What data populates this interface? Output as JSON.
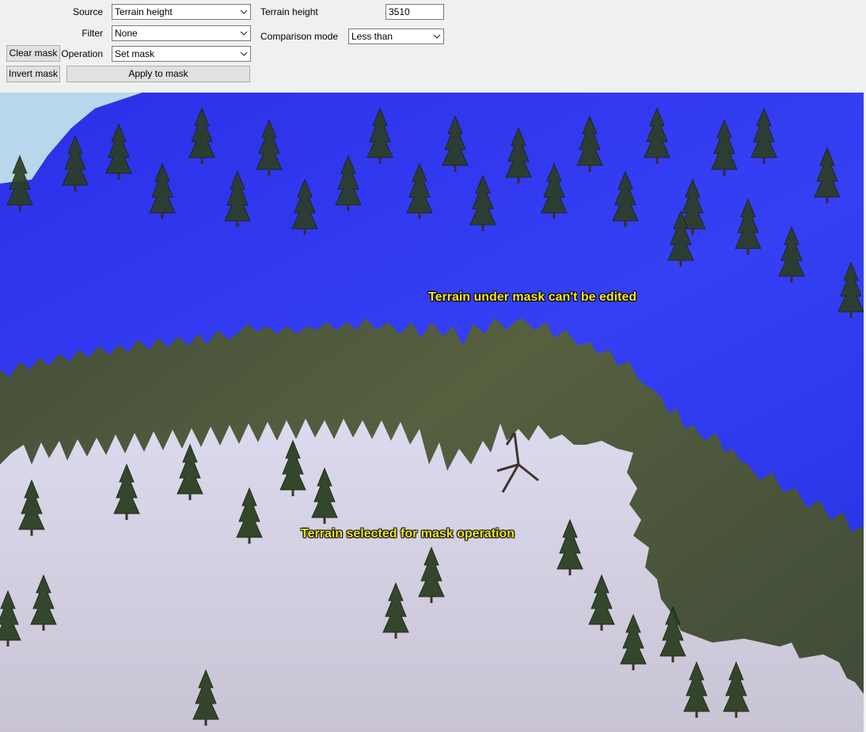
{
  "toolbar": {
    "source": {
      "label": "Source",
      "value": "Terrain height"
    },
    "filter": {
      "label": "Filter",
      "value": "None"
    },
    "operation": {
      "label": "Operation",
      "value": "Set mask"
    },
    "clear_mask_label": "Clear mask",
    "invert_mask_label": "Invert mask",
    "apply_label": "Apply to mask",
    "terrain_height": {
      "label": "Terrain height",
      "value": "3510"
    },
    "comparison_mode": {
      "label": "Comparison mode",
      "value": "Less than"
    },
    "icons": {
      "dropdown": "chevron-down-icon"
    }
  },
  "viewport": {
    "annotations": {
      "masked": "Terrain under mask can't be edited",
      "selected": "Terrain selected for mask operation"
    },
    "colors": {
      "mask_overlay": "#2f35f2",
      "selection_overlay": "#dcd9ea",
      "rock": "#4b5640",
      "sky": "#b8d7ec",
      "annotation_text": "#f5e81e"
    }
  }
}
